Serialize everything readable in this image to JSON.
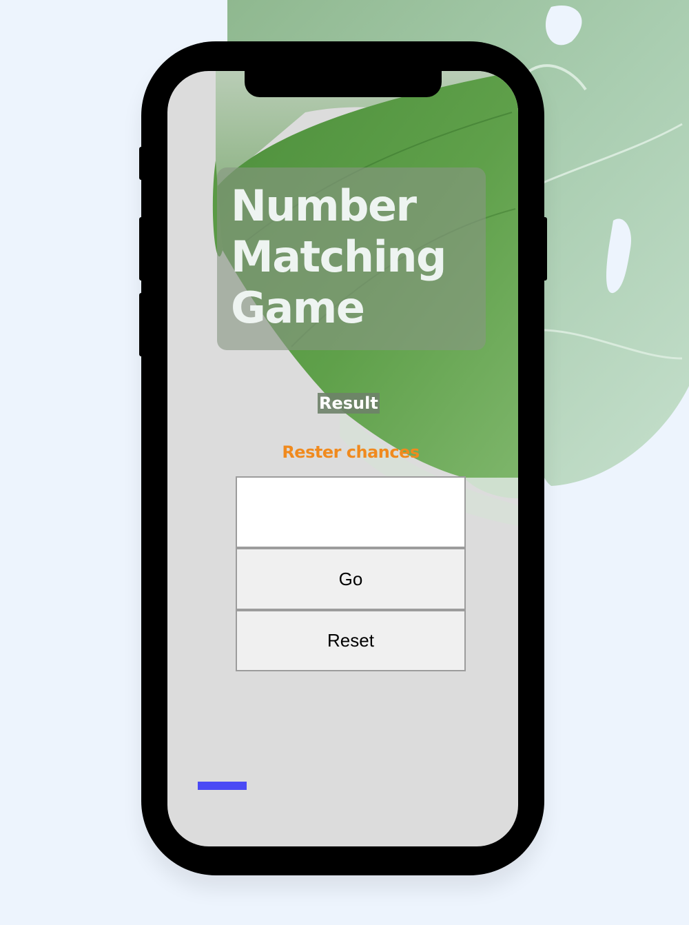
{
  "app": {
    "title_lines": [
      "Number",
      "Matching",
      "Game"
    ]
  },
  "status": {
    "result_label": "Result",
    "chances_label": "Rester chances"
  },
  "guess_input": {
    "value": "",
    "placeholder": ""
  },
  "buttons": {
    "go_label": "Go",
    "reset_label": "Reset"
  },
  "colors": {
    "page_background": "#edf4fd",
    "phone_frame": "#000000",
    "screen_background": "#dcdcdc",
    "title_text": "#eef4f1",
    "chances_text": "#f08a1e",
    "accent_bar": "#4a4af5"
  },
  "icons": {
    "background_decoration": "monstera-leaf-icon"
  }
}
